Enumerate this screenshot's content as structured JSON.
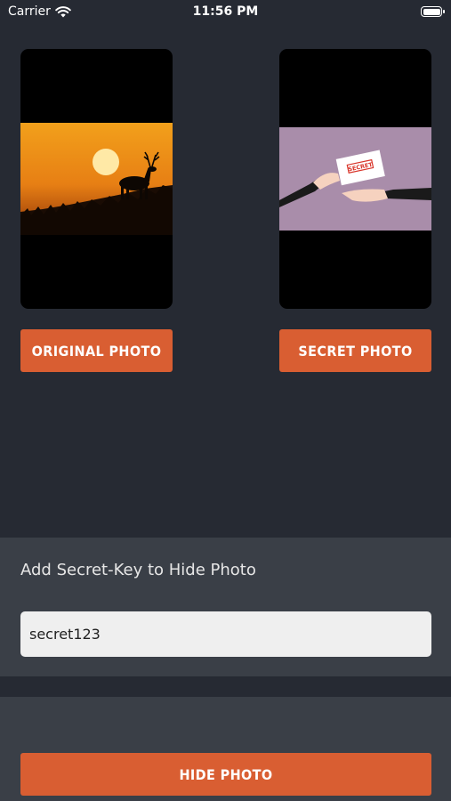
{
  "status_bar": {
    "carrier": "Carrier",
    "time": "11:56 PM"
  },
  "photos": {
    "original_button": "ORIGINAL PHOTO",
    "secret_button": "SECRET PHOTO",
    "secret_stamp": "SECRET"
  },
  "key_panel": {
    "label": "Add Secret-Key to Hide Photo",
    "input_value": "secret123"
  },
  "actions": {
    "hide_button": "HIDE PHOTO"
  },
  "colors": {
    "background": "#262a33",
    "panel": "#3a3f47",
    "accent": "#d95e32"
  }
}
